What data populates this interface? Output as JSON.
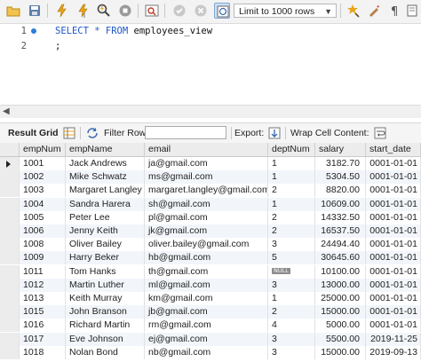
{
  "toolbar": {
    "icons": [
      "open-folder-icon",
      "save-icon",
      "execute-icon",
      "execute-current-icon",
      "explain-icon",
      "stop-icon",
      "toggle-output-icon",
      "commit-icon",
      "rollback-icon",
      "autocommit-icon",
      "beautify-icon",
      "find-icon",
      "invisible-chars-icon",
      "wrap-icon"
    ],
    "limit_label": "Limit to 1000 rows",
    "accent": "#e8a317"
  },
  "editor": {
    "lines": [
      {
        "number": "1",
        "text_kw": "SELECT * FROM",
        "text_rest": " employees_view"
      },
      {
        "number": "2",
        "text_kw": "",
        "text_rest": ";"
      }
    ]
  },
  "result_toolbar": {
    "result_grid": "Result Grid",
    "filter_rows": "Filter Rows:",
    "export": "Export:",
    "wrap": "Wrap Cell Content:"
  },
  "grid": {
    "columns": [
      "empNum",
      "empName",
      "email",
      "deptNum",
      "salary",
      "start_date"
    ],
    "null_label": "NULL",
    "rows": [
      [
        "1001",
        "Jack Andrews",
        "ja@gmail.com",
        "1",
        "3182.70",
        "0001-01-01"
      ],
      [
        "1002",
        "Mike Schwatz",
        "ms@gmail.com",
        "1",
        "5304.50",
        "0001-01-01"
      ],
      [
        "1003",
        "Margaret Langley",
        "margaret.langley@gmail.com",
        "2",
        "8820.00",
        "0001-01-01"
      ],
      [
        "1004",
        "Sandra Harera",
        "sh@gmail.com",
        "1",
        "10609.00",
        "0001-01-01"
      ],
      [
        "1005",
        "Peter Lee",
        "pl@gmail.com",
        "2",
        "14332.50",
        "0001-01-01"
      ],
      [
        "1006",
        "Jenny Keith",
        "jk@gmail.com",
        "2",
        "16537.50",
        "0001-01-01"
      ],
      [
        "1008",
        "Oliver Bailey",
        "oliver.bailey@gmail.com",
        "3",
        "24494.40",
        "0001-01-01"
      ],
      [
        "1009",
        "Harry Beker",
        "hb@gmail.com",
        "5",
        "30645.60",
        "0001-01-01"
      ],
      [
        "1011",
        "Tom Hanks",
        "th@gmail.com",
        "NULL",
        "10100.00",
        "0001-01-01"
      ],
      [
        "1012",
        "Martin Luther",
        "ml@gmail.com",
        "3",
        "13000.00",
        "0001-01-01"
      ],
      [
        "1013",
        "Keith Murray",
        "km@gmail.com",
        "1",
        "25000.00",
        "0001-01-01"
      ],
      [
        "1015",
        "John Branson",
        "jb@gmail.com",
        "2",
        "15000.00",
        "0001-01-01"
      ],
      [
        "1016",
        "Richard Martin",
        "rm@gmail.com",
        "4",
        "5000.00",
        "0001-01-01"
      ],
      [
        "1017",
        "Eve Johnson",
        "ej@gmail.com",
        "3",
        "5500.00",
        "2019-11-25"
      ],
      [
        "1018",
        "Nolan Bond",
        "nb@gmail.com",
        "3",
        "15000.00",
        "2019-09-13"
      ]
    ]
  }
}
